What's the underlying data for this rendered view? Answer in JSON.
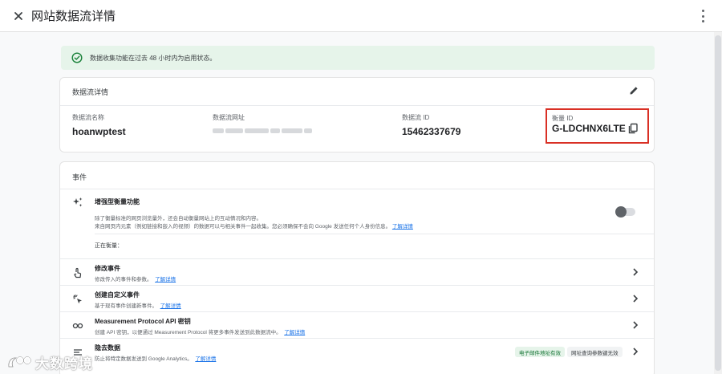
{
  "header": {
    "title": "网站数据流详情"
  },
  "banner": {
    "text": "数据收集功能在过去 48 小时内为启用状态。"
  },
  "stream_details": {
    "title": "数据流详情",
    "fields": [
      {
        "label": "数据流名称",
        "value": "hoanwptest"
      },
      {
        "label": "数据流网址",
        "value": ""
      },
      {
        "label": "数据流 ID",
        "value": "15462337679"
      },
      {
        "label": "衡量 ID",
        "value": "G-LDCHNX6LTE"
      }
    ]
  },
  "events": {
    "title": "事件",
    "enhanced": {
      "title": "增强型衡量功能",
      "desc1": "除了衡量标准的网页浏览量外，还会自动衡量网站上的互动情况和内容。",
      "desc2": "来自网页内元素（例如链接和嵌入的视频）的数据可以与相关事件一起收集。您必须确保不会向 Google 发送任何个人身份信息。",
      "link": "了解详情",
      "toggle_on": false,
      "measuring_label": "正在衡量："
    },
    "rows": [
      {
        "title": "修改事件",
        "desc": "修改传入的事件和参数。",
        "link": "了解详情"
      },
      {
        "title": "创建自定义事件",
        "desc": "基于现有事件创建新事件。",
        "link": "了解详情"
      },
      {
        "title": "Measurement Protocol API 密钥",
        "desc": "创建 API 密钥，以便通过 Measurement Protocol 将更多事件发送到此数据流中。",
        "link": "了解详情"
      },
      {
        "title": "隐去数据",
        "desc": "防止将特定数据发送到 Google Analytics。",
        "link": "了解详情"
      }
    ],
    "chips": {
      "green": "电子邮件地址有效",
      "grey": "网址查询参数键无效"
    }
  },
  "watermark": {
    "text": "大数跨境"
  },
  "colors": {
    "accent": "#1a73e8",
    "success_bg": "#e6f4ea",
    "highlight_border": "#d93025"
  }
}
